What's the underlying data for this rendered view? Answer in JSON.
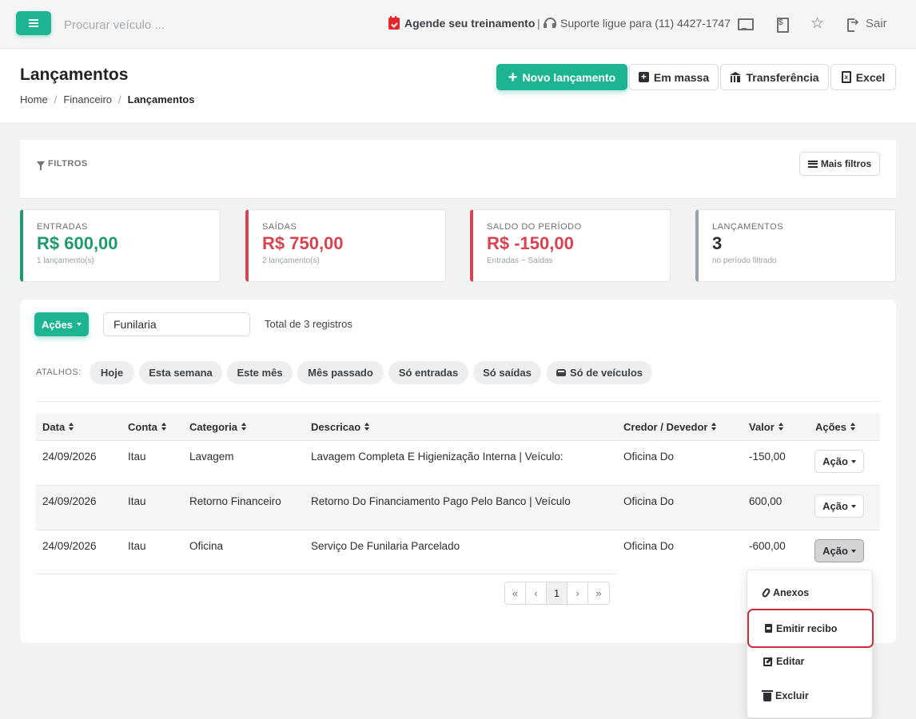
{
  "topbar": {
    "search_placeholder": "Procurar veículo ...",
    "training_label": "Agende seu treinamento",
    "separator": "|",
    "support_label": "Suporte ligue para (11) 4427-1747",
    "logout_label": "Sair",
    "icons": [
      "menu-icon",
      "calendar-check-icon",
      "headset-icon",
      "monitor-icon",
      "invoice-icon",
      "star-icon",
      "logout-icon"
    ]
  },
  "header": {
    "title": "Lançamentos",
    "breadcrumb": [
      "Home",
      "Financeiro",
      "Lançamentos"
    ],
    "breadcrumb_sep": "/",
    "buttons": {
      "new": "Novo lançamento",
      "mass": "Em massa",
      "transfer": "Transferência",
      "excel": "Excel"
    }
  },
  "filters": {
    "label": "FILTROS",
    "more_filters": "Mais filtros"
  },
  "stats": [
    {
      "label": "ENTRADAS",
      "value": "R$ 600,00",
      "sub": "1 lançamento(s)",
      "color": "#1e9a72"
    },
    {
      "label": "SAÍDAS",
      "value": "R$ 750,00",
      "sub": "2 lançamento(s)",
      "color": "#d9424f"
    },
    {
      "label": "SALDO DO PERÍODO",
      "value": "R$ -150,00",
      "sub": "Entradas − Saídas",
      "color": "#d9424f"
    },
    {
      "label": "LANÇAMENTOS",
      "value": "3",
      "sub": "no período filtrado",
      "color": "#9aa0a6"
    }
  ],
  "table_card": {
    "actions_label": "Ações",
    "search_value": "Funilaria",
    "total_text": "Total de 3 registros",
    "shortcuts_label": "ATALHOS:",
    "chips": [
      "Hoje",
      "Esta semana",
      "Este mês",
      "Mês passado",
      "Só entradas",
      "Só saídas",
      "Só de veículos"
    ]
  },
  "table": {
    "columns": [
      "Data",
      "Conta",
      "Categoria",
      "Descricao",
      "Credor / Devedor",
      "Valor",
      "Ações"
    ],
    "rows": [
      {
        "data": "24/09/2026",
        "conta": "Itau",
        "categoria": "Lavagem",
        "descricao": "Lavagem Completa E Higienização Interna | Veículo:",
        "credor": "Oficina Do",
        "valor": "-150,00",
        "acao": "Ação"
      },
      {
        "data": "24/09/2026",
        "conta": "Itau",
        "categoria": "Retorno Financeiro",
        "descricao": "Retorno Do Financiamento Pago Pelo Banco | Veículo",
        "credor": "Oficina Do",
        "valor": "600,00",
        "acao": "Ação"
      },
      {
        "data": "24/09/2026",
        "conta": "Itau",
        "categoria": "Oficina",
        "descricao": "Serviço De Funilaria Parcelado",
        "credor": "Oficina Do",
        "valor": "-600,00",
        "acao": "Ação"
      }
    ]
  },
  "pagination": {
    "first": "«",
    "prev": "‹",
    "current": "1",
    "next": "›",
    "last": "»"
  },
  "dropdown": {
    "items": [
      "Anexos",
      "Emitir recibo",
      "Editar",
      "Excluir"
    ],
    "highlighted": "Emitir recibo"
  }
}
